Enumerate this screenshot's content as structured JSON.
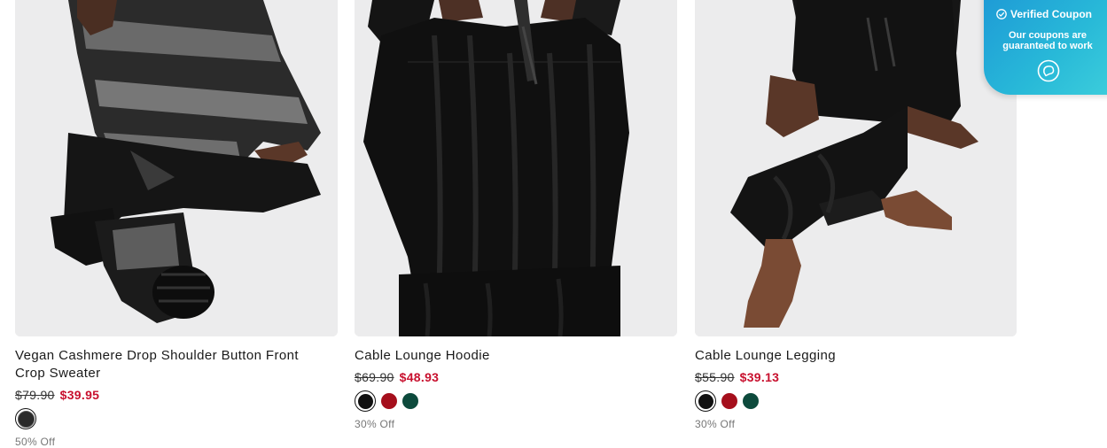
{
  "products": [
    {
      "name": "Vegan Cashmere Drop Shoulder Button Front Crop Sweater",
      "price_old": "$79.90",
      "price_new": "$39.95",
      "swatches": [
        {
          "color": "#1f1f1f",
          "selected": true
        }
      ],
      "discount": "50% Off"
    },
    {
      "name": "Cable Lounge Hoodie",
      "price_old": "$69.90",
      "price_new": "$48.93",
      "swatches": [
        {
          "color": "#111111",
          "selected": true
        },
        {
          "color": "#a50f1c",
          "selected": false
        },
        {
          "color": "#0d4a3c",
          "selected": false
        }
      ],
      "discount": "30% Off"
    },
    {
      "name": "Cable Lounge Legging",
      "price_old": "$55.90",
      "price_new": "$39.13",
      "swatches": [
        {
          "color": "#111111",
          "selected": true
        },
        {
          "color": "#a50f1c",
          "selected": false
        },
        {
          "color": "#0d4a3c",
          "selected": false
        }
      ],
      "discount": "30% Off"
    }
  ],
  "coupon": {
    "title": "Verified Coupon",
    "subtitle_line1": "Our coupons are",
    "subtitle_line2": "guaranteed to work",
    "icon": "chat-bubble-icon"
  },
  "colors": {
    "sale_price": "#c8102e",
    "coupon_gradient_start": "#1e9ad6",
    "coupon_gradient_end": "#3fd0dc"
  }
}
